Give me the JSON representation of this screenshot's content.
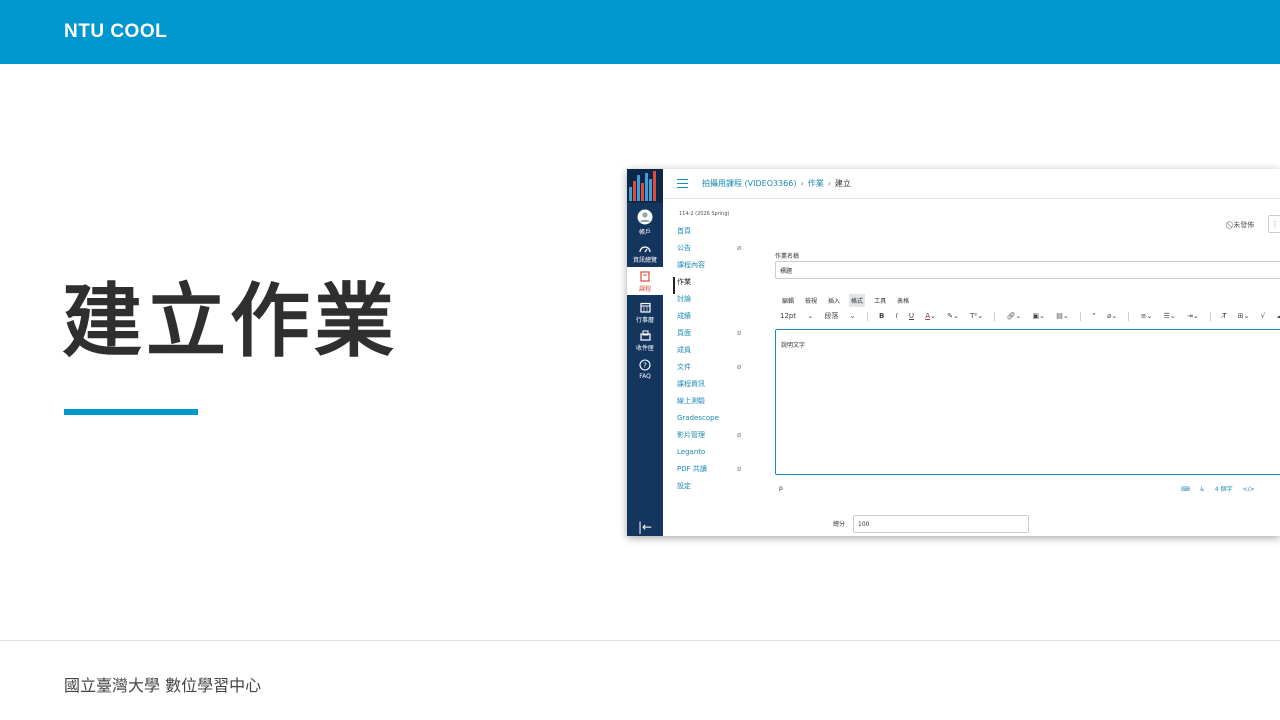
{
  "header": {
    "brand": "NTU COOL",
    "bg_color": "#0097ce"
  },
  "slide": {
    "title": "建立作業",
    "accent_color": "#0097ce"
  },
  "footer": {
    "org": "國立臺灣大學 數位學習中心"
  },
  "screenshot": {
    "global_nav": {
      "items": [
        {
          "label": "帳戶",
          "icon": "user-avatar-icon"
        },
        {
          "label": "資訊總覽",
          "icon": "dashboard-icon"
        },
        {
          "label": "課程",
          "icon": "book-icon"
        },
        {
          "label": "行事曆",
          "icon": "calendar-icon"
        },
        {
          "label": "收件匣",
          "icon": "inbox-icon"
        },
        {
          "label": "FAQ",
          "icon": "help-icon"
        }
      ],
      "collapse": "|←"
    },
    "breadcrumb": {
      "course": "拍攝用課程 (VIDEO3366)",
      "section": "作業",
      "current": "建立"
    },
    "term": "114-2 (2026 Spring)",
    "course_nav": [
      {
        "label": "首頁",
        "hidden": false
      },
      {
        "label": "公告",
        "hidden": true
      },
      {
        "label": "課程內容",
        "hidden": false
      },
      {
        "label": "作業",
        "hidden": false,
        "active": true
      },
      {
        "label": "討論",
        "hidden": false
      },
      {
        "label": "成績",
        "hidden": false
      },
      {
        "label": "頁面",
        "hidden": true
      },
      {
        "label": "成員",
        "hidden": false
      },
      {
        "label": "文件",
        "hidden": true
      },
      {
        "label": "課程資訊",
        "hidden": false
      },
      {
        "label": "線上測驗",
        "hidden": false
      },
      {
        "label": "Gradescope",
        "hidden": false
      },
      {
        "label": "影片管理",
        "hidden": true
      },
      {
        "label": "Leganto",
        "hidden": false
      },
      {
        "label": "PDF 共讀",
        "hidden": true
      },
      {
        "label": "設定",
        "hidden": false
      }
    ],
    "publish_status": "未發佈",
    "form": {
      "name_label": "作業名稱",
      "name_value": "標題",
      "menu": [
        "編輯",
        "檢視",
        "插入",
        "格式",
        "工具",
        "表格"
      ],
      "toolbar": {
        "font_size": "12pt",
        "block": "段落"
      },
      "editor_text": "說明文字",
      "status_path": "p",
      "word_count": "4 個字",
      "html_toggle": "</>",
      "points_label": "總分",
      "points_value": "100"
    }
  }
}
